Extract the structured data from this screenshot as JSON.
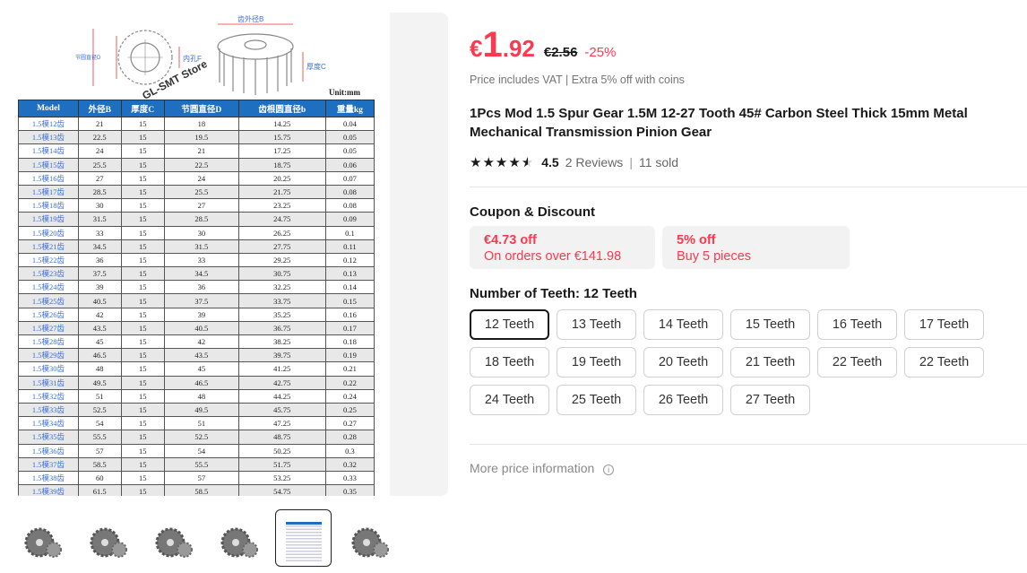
{
  "gallery": {
    "watermark": "GL-SMT Store",
    "unit": "Unit:mm",
    "diagram_labels": {
      "outer_diameter": "齿外径B",
      "bore": "内孔F",
      "thickness": "厚度C",
      "pitch": "节圆直径D",
      "root": "齿根圆直径b"
    },
    "table": {
      "headers": [
        "Model",
        "外径B",
        "厚度C",
        "节圆直径D",
        "齿根圆直径b",
        "重量kg"
      ],
      "rows": [
        [
          "1.5模12齿",
          "21",
          "15",
          "18",
          "14.25",
          "0.04"
        ],
        [
          "1.5模13齿",
          "22.5",
          "15",
          "19.5",
          "15.75",
          "0.05"
        ],
        [
          "1.5模14齿",
          "24",
          "15",
          "21",
          "17.25",
          "0.05"
        ],
        [
          "1.5模15齿",
          "25.5",
          "15",
          "22.5",
          "18.75",
          "0.06"
        ],
        [
          "1.5模16齿",
          "27",
          "15",
          "24",
          "20.25",
          "0.07"
        ],
        [
          "1.5模17齿",
          "28.5",
          "15",
          "25.5",
          "21.75",
          "0.08"
        ],
        [
          "1.5模18齿",
          "30",
          "15",
          "27",
          "23.25",
          "0.08"
        ],
        [
          "1.5模19齿",
          "31.5",
          "15",
          "28.5",
          "24.75",
          "0.09"
        ],
        [
          "1.5模20齿",
          "33",
          "15",
          "30",
          "26.25",
          "0.1"
        ],
        [
          "1.5模21齿",
          "34.5",
          "15",
          "31.5",
          "27.75",
          "0.11"
        ],
        [
          "1.5模22齿",
          "36",
          "15",
          "33",
          "29.25",
          "0.12"
        ],
        [
          "1.5模23齿",
          "37.5",
          "15",
          "34.5",
          "30.75",
          "0.13"
        ],
        [
          "1.5模24齿",
          "39",
          "15",
          "36",
          "32.25",
          "0.14"
        ],
        [
          "1.5模25齿",
          "40.5",
          "15",
          "37.5",
          "33.75",
          "0.15"
        ],
        [
          "1.5模26齿",
          "42",
          "15",
          "39",
          "35.25",
          "0.16"
        ],
        [
          "1.5模27齿",
          "43.5",
          "15",
          "40.5",
          "36.75",
          "0.17"
        ],
        [
          "1.5模28齿",
          "45",
          "15",
          "42",
          "38.25",
          "0.18"
        ],
        [
          "1.5模29齿",
          "46.5",
          "15",
          "43.5",
          "39.75",
          "0.19"
        ],
        [
          "1.5模30齿",
          "48",
          "15",
          "45",
          "41.25",
          "0.21"
        ],
        [
          "1.5模31齿",
          "49.5",
          "15",
          "46.5",
          "42.75",
          "0.22"
        ],
        [
          "1.5模32齿",
          "51",
          "15",
          "48",
          "44.25",
          "0.24"
        ],
        [
          "1.5模33齿",
          "52.5",
          "15",
          "49.5",
          "45.75",
          "0.25"
        ],
        [
          "1.5模34齿",
          "54",
          "15",
          "51",
          "47.25",
          "0.27"
        ],
        [
          "1.5模35齿",
          "55.5",
          "15",
          "52.5",
          "48.75",
          "0.28"
        ],
        [
          "1.5模36齿",
          "57",
          "15",
          "54",
          "50.25",
          "0.3"
        ],
        [
          "1.5模37齿",
          "58.5",
          "15",
          "55.5",
          "51.75",
          "0.32"
        ],
        [
          "1.5模38齿",
          "60",
          "15",
          "57",
          "53.25",
          "0.33"
        ],
        [
          "1.5模39齿",
          "61.5",
          "15",
          "58.5",
          "54.75",
          "0.35"
        ]
      ]
    },
    "thumbnails": [
      "gear-set-1",
      "gear-rack",
      "gear-pair",
      "single-gear",
      "spec-table",
      "gear-set-2"
    ],
    "selected_thumbnail": 4
  },
  "price": {
    "currency": "€",
    "integer": "1",
    "decimal": ".92",
    "original": "€2.56",
    "discount": "-25%"
  },
  "vat_note": "Price includes VAT",
  "coins_note": "Extra 5% off with coins",
  "title": "1Pcs Mod 1.5 Spur Gear 1.5M 12-27 Tooth 45# Carbon Steel Thick 15mm Metal Mechanical Transmission Pinion Gear",
  "rating": {
    "value": "4.5",
    "reviews": "2 Reviews",
    "sold": "11 sold",
    "stars": 4.5
  },
  "coupons": {
    "heading": "Coupon & Discount",
    "items": [
      {
        "amount": "€4.73 off",
        "condition": "On orders over €141.98"
      },
      {
        "amount": "5% off",
        "condition": "Buy 5 pieces"
      }
    ]
  },
  "teeth": {
    "heading": "Number of Teeth: 12 Teeth",
    "options": [
      "12 Teeth",
      "13 Teeth",
      "14 Teeth",
      "15 Teeth",
      "16 Teeth",
      "17 Teeth",
      "18 Teeth",
      "19 Teeth",
      "20 Teeth",
      "21 Teeth",
      "22 Teeth",
      "22 Teeth",
      "24 Teeth",
      "25 Teeth",
      "26 Teeth",
      "27 Teeth"
    ],
    "selected": 0
  },
  "more_price": "More price information",
  "colors": {
    "accent": "#fd384f",
    "table_header": "#1f6fc0"
  }
}
